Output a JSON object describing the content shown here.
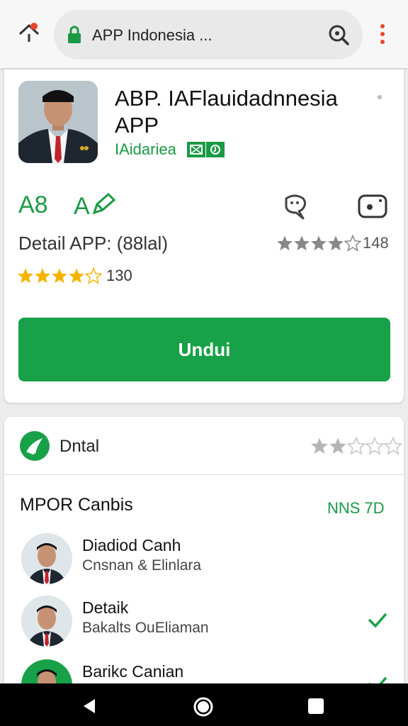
{
  "browser": {
    "url_text": "APP Indonesia ..."
  },
  "app": {
    "title": "ABP. IAFlauidadnnesia APP",
    "developer": "IAidariea",
    "age_label": "A8",
    "age_label_2": "A",
    "detail_text": "Detail APP: (88lal)",
    "rating_gray_count": "148",
    "rating_gray_stars": 4,
    "rating_yellow_count": "130",
    "rating_yellow_stars": 4,
    "download_label": "Undui"
  },
  "reviews": {
    "label": "Dntal",
    "stars": 2,
    "section_title": "MPOR Canbis",
    "section_link": "NNS 7D",
    "items": [
      {
        "name": "Diadiod Canh",
        "subtitle": "Cnsnan & Elinlara",
        "checked": false
      },
      {
        "name": "Detaik",
        "subtitle": "Bakalts OuEliaman",
        "checked": true
      },
      {
        "name": "Barikc Canian",
        "subtitle": "",
        "checked": true
      }
    ]
  },
  "colors": {
    "accent": "#18a149",
    "star_yellow": "#f5b301",
    "star_gray": "#888888"
  }
}
